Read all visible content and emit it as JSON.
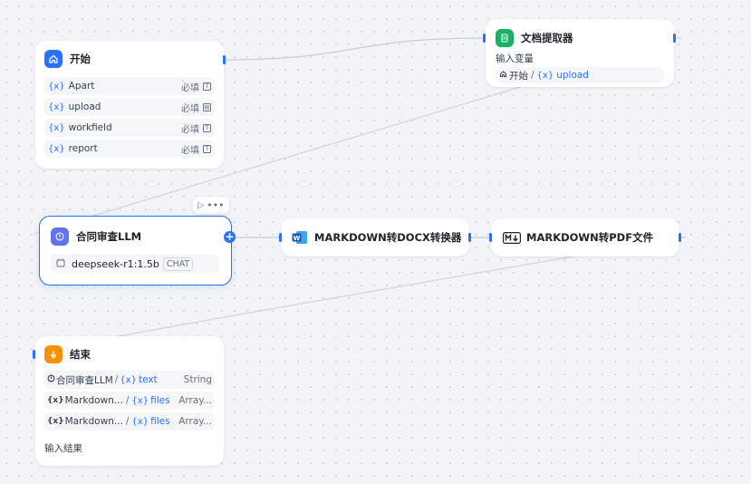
{
  "nodes": {
    "start": {
      "title": "开始",
      "variables": [
        {
          "symbol": "{x}",
          "name": "Apart",
          "required": "必填",
          "type_icon": "text-type-icon"
        },
        {
          "symbol": "{x}",
          "name": "upload",
          "required": "必填",
          "type_icon": "file-type-icon"
        },
        {
          "symbol": "{x}",
          "name": "workfield",
          "required": "必填",
          "type_icon": "text-type-icon"
        },
        {
          "symbol": "{x}",
          "name": "report",
          "required": "必填",
          "type_icon": "text-type-icon"
        }
      ]
    },
    "doc_extractor": {
      "title": "文档提取器",
      "input_label": "输入变量",
      "input_source": "开始",
      "input_separator": "/",
      "input_symbol": "{x}",
      "input_var": "upload"
    },
    "llm": {
      "title": "合同审查LLM",
      "model": "deepseek-r1:1.5b",
      "mode_badge": "CHAT"
    },
    "md2docx": {
      "title": "MARKDOWN转DOCX转换器"
    },
    "md2pdf": {
      "title": "MARKDOWN转PDF文件"
    },
    "end": {
      "title": "结束",
      "outputs": [
        {
          "source": "合同审查LLM",
          "sep": "/",
          "symbol": "{x}",
          "var": "text",
          "type": "String"
        },
        {
          "source": "Markdown...",
          "sep": "/",
          "symbol": "{x}",
          "var": "files",
          "type": "Array..."
        },
        {
          "source": "Markdown...",
          "sep": "/",
          "symbol": "{x}",
          "var": "files",
          "type": "Array..."
        }
      ],
      "footer_label": "输入结果"
    }
  },
  "colors": {
    "accent": "#2970ff",
    "start_icon_bg": "#2970ff",
    "doc_icon_bg": "#16b364",
    "llm_icon_bg": "#6172f3",
    "end_icon_bg": "#f79009"
  }
}
